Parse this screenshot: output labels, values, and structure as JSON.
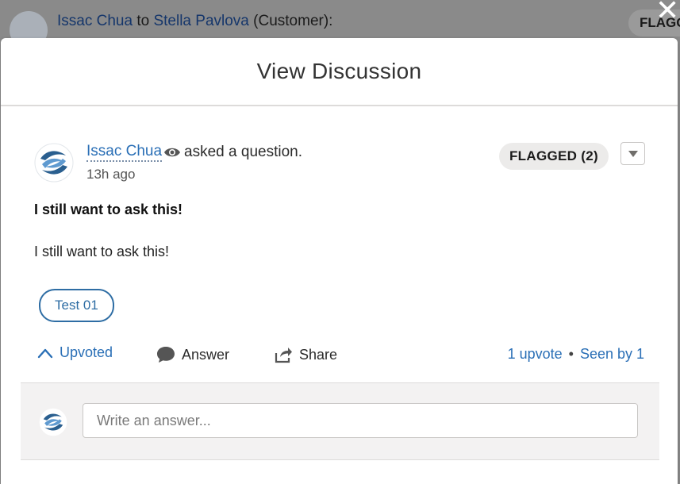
{
  "background_feed": {
    "from_name": "Issac Chua",
    "to_word": "to",
    "to_name": "Stella Pavlova",
    "to_role": "(Customer):",
    "flag_label": "FLAGG"
  },
  "modal": {
    "close_label": "✕",
    "title": "View Discussion"
  },
  "post": {
    "author": "Issac Chua",
    "action_text": "asked a question.",
    "timestamp": "13h ago",
    "flag_badge": "FLAGGED (2)",
    "question_title": "I still want to ask this!",
    "question_body": "I still want to ask this!",
    "topic": "Test 01"
  },
  "actions": {
    "upvote_label": "Upvoted",
    "answer_label": "Answer",
    "share_label": "Share",
    "upvote_count": "1 upvote",
    "separator": "•",
    "seen_by": "Seen by 1"
  },
  "answer": {
    "placeholder": "Write an answer..."
  },
  "icons": {
    "avatar": "hands-logo-avatar",
    "eye": "eye-icon",
    "menu": "chevron-down-icon",
    "upvote": "chevron-up-icon",
    "answer": "speech-bubble-icon",
    "share": "share-arrow-icon"
  },
  "colors": {
    "link": "#2a6fb6",
    "badge_bg": "#ecebea",
    "overlay": "#7c7c7c",
    "answer_bg": "#f3f2f2"
  }
}
